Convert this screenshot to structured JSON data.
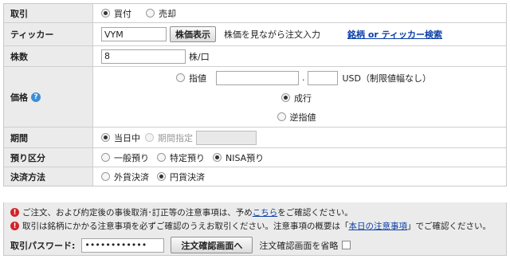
{
  "trade": {
    "label": "取引",
    "options": [
      "買付",
      "売却"
    ],
    "selected": 0
  },
  "ticker": {
    "label": "ティッカー",
    "value": "VYM",
    "button": "株価表示",
    "hint": "株価を見ながら注文入力",
    "search_link": "銘柄 or ティッカー検索"
  },
  "shares": {
    "label": "株数",
    "value": "8",
    "unit": "株/口"
  },
  "price": {
    "label": "価格",
    "help_icon": "question-icon",
    "limit_label": "指値",
    "dot": ".",
    "currency_note": "USD（制限値幅なし）",
    "market_label": "成行",
    "stop_label": "逆指値",
    "selected": "market"
  },
  "period": {
    "label": "期間",
    "today": "当日中",
    "specified": "期間指定"
  },
  "custody": {
    "label": "預り区分",
    "options": [
      "一般預り",
      "特定預り",
      "NISA預り"
    ],
    "selected": 2
  },
  "settlement": {
    "label": "決済方法",
    "options": [
      "外貨決済",
      "円貨決済"
    ],
    "selected": 1
  },
  "notes": {
    "line1_a": "ご注文、および約定後の事後取消･訂正等の注意事項は、予め",
    "line1_link": "こちら",
    "line1_b": "をご確認ください。",
    "line2_a": "取引は銘柄にかかる注意事項を必ずご確認のうえお取引ください。注意事項の概要は「",
    "line2_link": "本日の注意事項",
    "line2_b": "」でご確認ください。"
  },
  "password": {
    "label": "取引パスワード:",
    "value": "••••••••••••",
    "confirm_button": "注文確認画面へ",
    "skip_label": "注文確認画面を省略"
  },
  "colors": {
    "label_bg": "#ebebeb",
    "link": "#0b3fa8",
    "warning": "#d3222a",
    "help": "#3b8ed8"
  }
}
